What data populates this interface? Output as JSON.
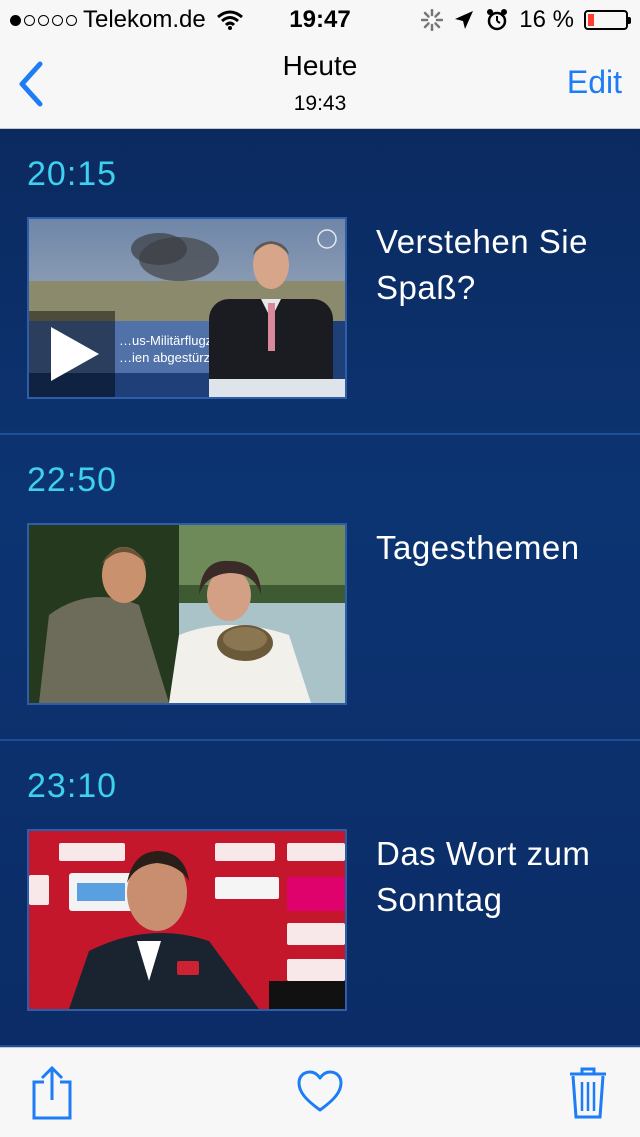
{
  "status_bar": {
    "carrier": "Telekom.de",
    "time": "19:47",
    "battery": "16 %",
    "battery_level": 0.16
  },
  "navbar": {
    "title": "Heute",
    "subtitle": "19:43",
    "edit_label": "Edit"
  },
  "programs": [
    {
      "time": "20:15",
      "title": "Verstehen Sie Spaß?",
      "thumb_caption_1": "…us-Militärflugzeug",
      "thumb_caption_2": "…ien abgestürzt"
    },
    {
      "time": "22:50",
      "title": "Tagesthemen"
    },
    {
      "time": "23:10",
      "title": "Das Wort zum Sonntag"
    }
  ],
  "colors": {
    "accent": "#1e7cf5",
    "time_text": "#3ed0ee",
    "background": "#0b2a5e"
  },
  "icons": {
    "back": "chevron-left-icon",
    "share": "share-icon",
    "favorite": "heart-icon",
    "delete": "trash-icon"
  }
}
